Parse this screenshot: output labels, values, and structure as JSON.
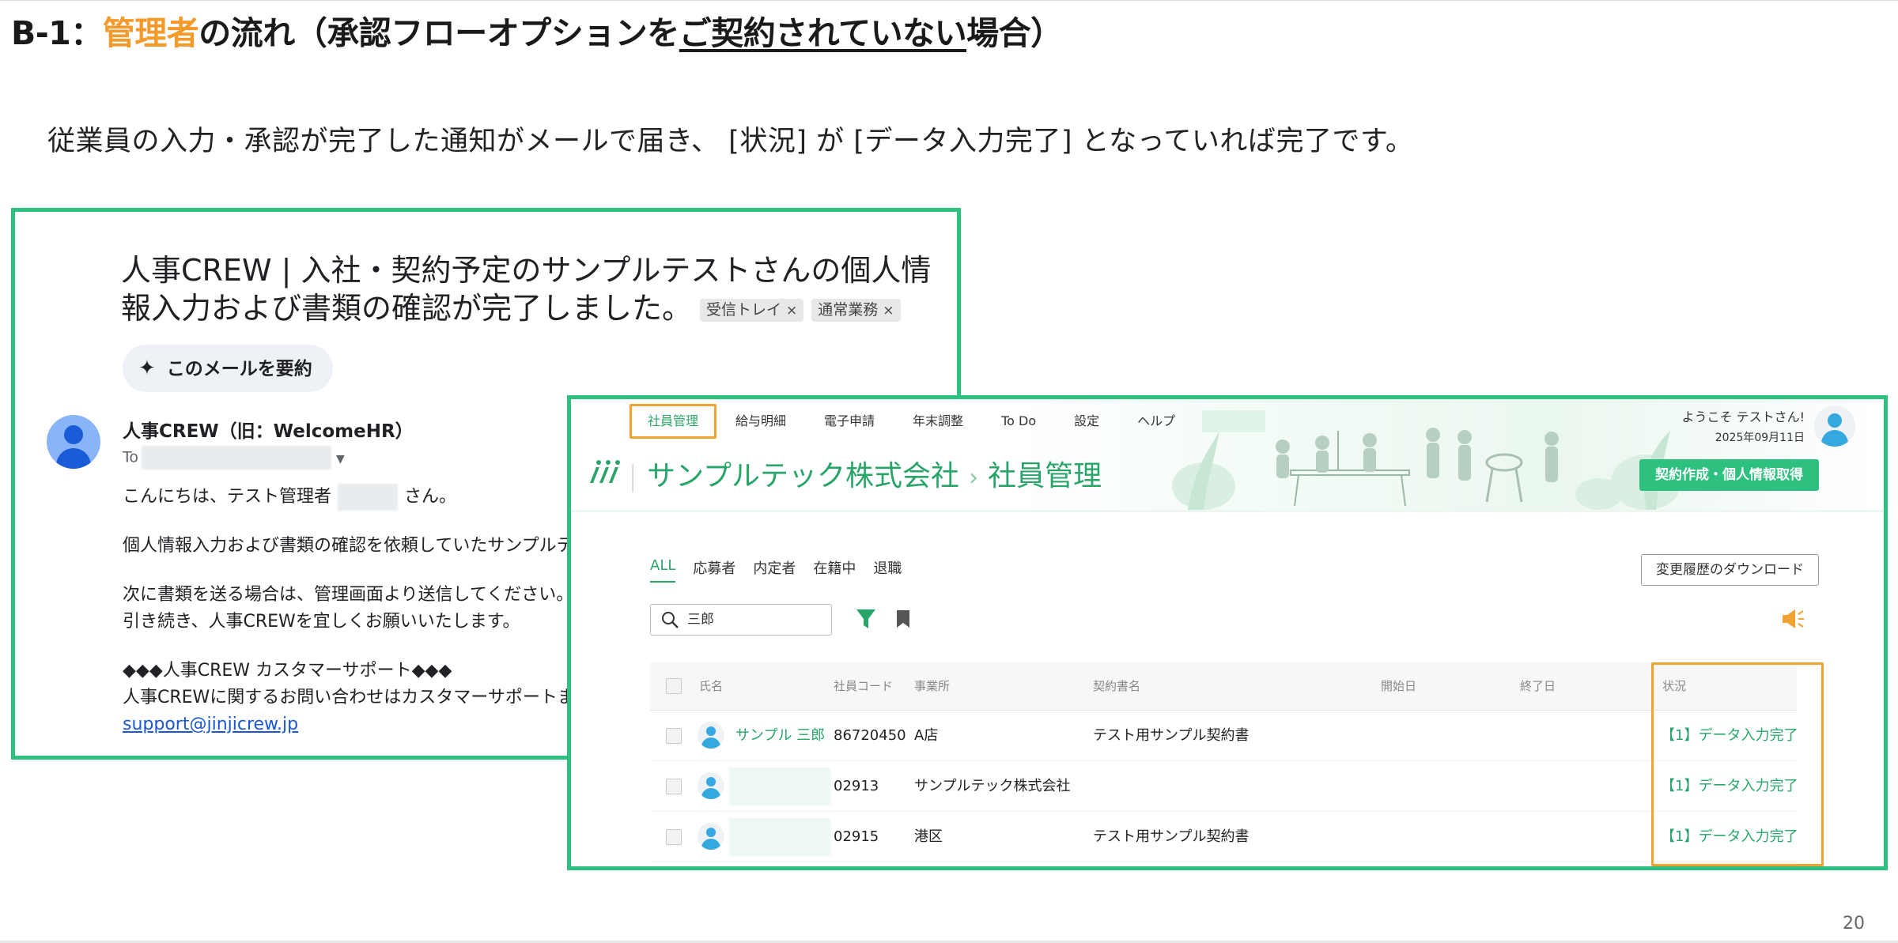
{
  "slide": {
    "title_prefix": "B-1：",
    "title_highlight": "管理者",
    "title_middle": "の流れ（承認フローオプションを",
    "title_underlined": "ご契約されていない",
    "title_suffix": "場合）",
    "subtitle": "従業員の入力・承認が完了した通知がメールで届き、 [状況] が [データ入力完了] となっていれば完了です。",
    "page_number": "20"
  },
  "colors": {
    "accent_orange": "#f39a2b",
    "frame_green": "#2ec07e",
    "brand_green": "#2aa56a",
    "link_blue": "#1a57d4"
  },
  "email": {
    "subject": "人事CREW | 入社・契約予定のサンプルテストさんの個人情報入力および書類の確認が完了しました。",
    "labels": [
      "受信トレイ",
      "通常業務"
    ],
    "label_remove_icon": "close-icon",
    "summarize_button": "このメールを要約",
    "summarize_icon": "sparkle-icon",
    "sender": "人事CREW（旧：WelcomeHR）",
    "to_label": "To",
    "greeting_before": "こんにちは、テスト管理者",
    "greeting_after": "さん。",
    "body_line1": "個人情報入力および書類の確認を依頼していたサンプルテ",
    "body_line2": "次に書類を送る場合は、管理画面より送信してください。",
    "body_line3": "引き続き、人事CREWを宜しくお願いいたします。",
    "support_heading": "◆◆◆人事CREW カスタマーサポート◆◆◆",
    "support_line": "人事CREWに関するお問い合わせはカスタマーサポートま",
    "support_email": "support@jinjicrew.jp"
  },
  "admin": {
    "nav": [
      "社員管理",
      "給与明細",
      "電子申請",
      "年末調整",
      "To Do",
      "設定",
      "ヘルプ"
    ],
    "active_nav": "社員管理",
    "company": "サンプルテック株式会社",
    "section": "社員管理",
    "welcome": "ようこそ テストさん!",
    "date": "2025年09月11日",
    "contract_button": "契約作成・個人情報取得",
    "filter_tabs": [
      "ALL",
      "応募者",
      "内定者",
      "在籍中",
      "退職"
    ],
    "active_filter": "ALL",
    "download_button": "変更履歴のダウンロード",
    "search_value": "三郎",
    "table": {
      "headers": [
        "氏名",
        "社員コード",
        "事業所",
        "契約書名",
        "開始日",
        "終了日",
        "状況"
      ],
      "rows": [
        {
          "name": "サンプル 三郎",
          "code": "86720450",
          "office": "A店",
          "contract": "テスト用サンプル契約書",
          "start": "",
          "end": "",
          "status": "【1】データ入力完了"
        },
        {
          "name": "",
          "code": "02913",
          "office": "サンプルテック株式会社",
          "contract": "",
          "start": "",
          "end": "",
          "status": "【1】データ入力完了"
        },
        {
          "name": "",
          "code": "02915",
          "office": "港区",
          "contract": "テスト用サンプル契約書",
          "start": "",
          "end": "",
          "status": "【1】データ入力完了"
        }
      ]
    }
  }
}
